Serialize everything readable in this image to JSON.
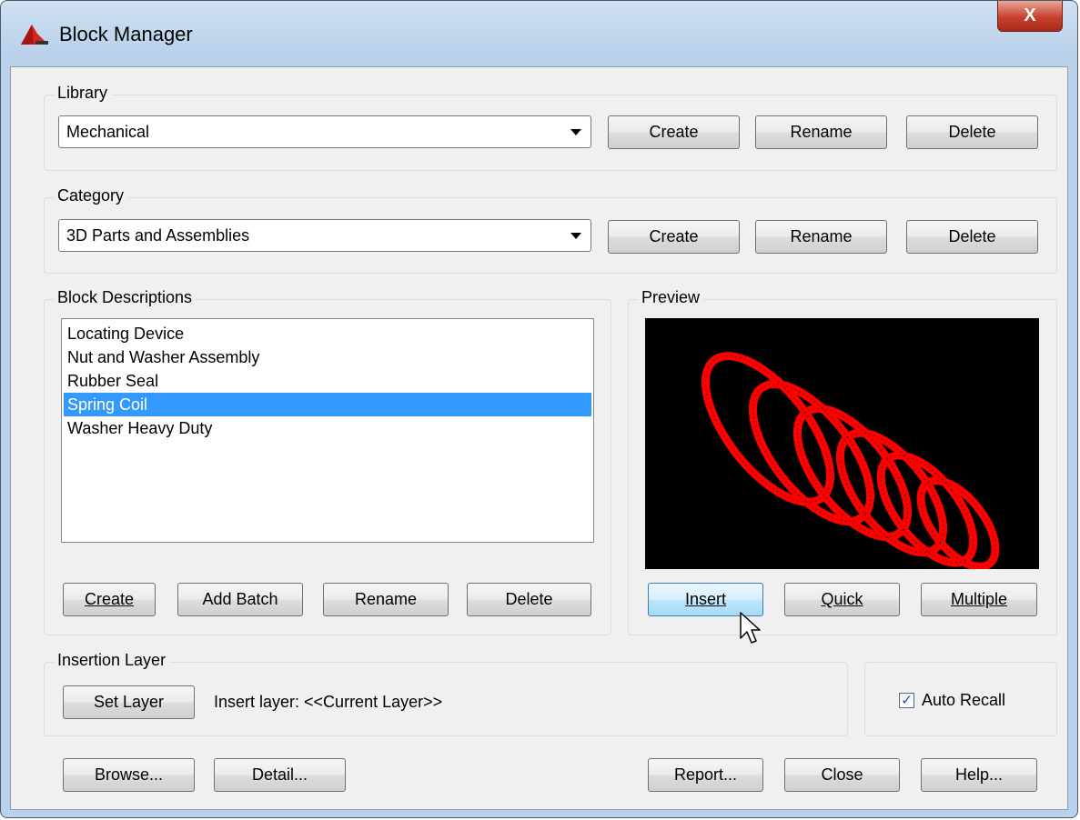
{
  "window": {
    "title": "Block Manager",
    "close_glyph": "X"
  },
  "library": {
    "label": "Library",
    "selected": "Mechanical",
    "create": "Create",
    "rename": "Rename",
    "delete": "Delete"
  },
  "category": {
    "label": "Category",
    "selected": "3D Parts and Assemblies",
    "create": "Create",
    "rename": "Rename",
    "delete": "Delete"
  },
  "blocks": {
    "label": "Block Descriptions",
    "items": [
      {
        "label": "Locating Device",
        "selected": false
      },
      {
        "label": "Nut and Washer Assembly",
        "selected": false
      },
      {
        "label": "Rubber Seal",
        "selected": false
      },
      {
        "label": "Spring Coil",
        "selected": true
      },
      {
        "label": "Washer Heavy Duty",
        "selected": false
      }
    ],
    "create": "Create",
    "add_batch": "Add Batch",
    "rename": "Rename",
    "delete": "Delete"
  },
  "preview": {
    "label": "Preview",
    "insert": "Insert",
    "quick": "Quick",
    "multiple": "Multiple",
    "coil_color": "#ff0000"
  },
  "insertion_layer": {
    "label": "Insertion Layer",
    "set_layer": "Set Layer",
    "text": "Insert layer: <<Current Layer>>"
  },
  "auto_recall": {
    "label": "Auto Recall",
    "checked": true
  },
  "footer": {
    "browse": "Browse...",
    "detail": "Detail...",
    "report": "Report...",
    "close": "Close",
    "help": "Help..."
  },
  "colors": {
    "selection": "#3399ff",
    "preview_bg": "#000000",
    "close_red": "#c6402c"
  }
}
